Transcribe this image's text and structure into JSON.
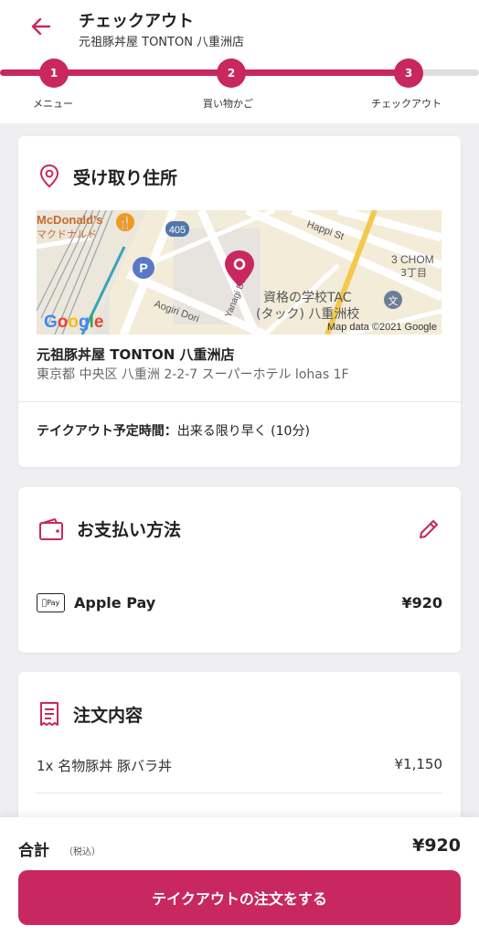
{
  "header": {
    "title": "チェックアウト",
    "subtitle": "元祖豚丼屋 TONTON 八重洲店"
  },
  "progress": {
    "steps": [
      {
        "number": "1",
        "label": "メニュー"
      },
      {
        "number": "2",
        "label": "買い物かご"
      },
      {
        "number": "3",
        "label": "チェックアウト"
      }
    ],
    "current_step": 3,
    "accent": "#c8285f"
  },
  "pickup": {
    "title": "受け取り住所",
    "map": {
      "labels": {
        "mcdonalds": "McDonald's",
        "mcdonalds_jp": "マクドナルド",
        "route": "405",
        "happi": "Happi St",
        "chome_en": "3 CHOM",
        "chome_jp": "3丁目",
        "yanagi": "Yanagi Dori St",
        "aogiri": "Aogiri Dori",
        "tac1": "資格の学校TAC",
        "tac2": "(タック) 八重洲校",
        "google": "Google",
        "attribution": "Map data ©2021 Google"
      }
    },
    "store_name": "元祖豚丼屋 TONTON 八重洲店",
    "address": "東京都 中央区 八重洲 2-2-7 スーパーホテル lohas 1F",
    "time_label": "テイクアウト予定時間：",
    "time_value": "出来る限り早く (10分)"
  },
  "payment": {
    "title": "お支払い方法",
    "badge": "Pay",
    "method": "Apple Pay",
    "amount": "¥920"
  },
  "order": {
    "title": "注文内容",
    "items": [
      {
        "line": "1x  名物豚丼 豚バラ丼",
        "price": "¥1,150"
      }
    ]
  },
  "footer": {
    "total_label": "合計",
    "tax_label": "（税込）",
    "total_amount": "¥920",
    "button_label": "テイクアウトの注文をする"
  }
}
